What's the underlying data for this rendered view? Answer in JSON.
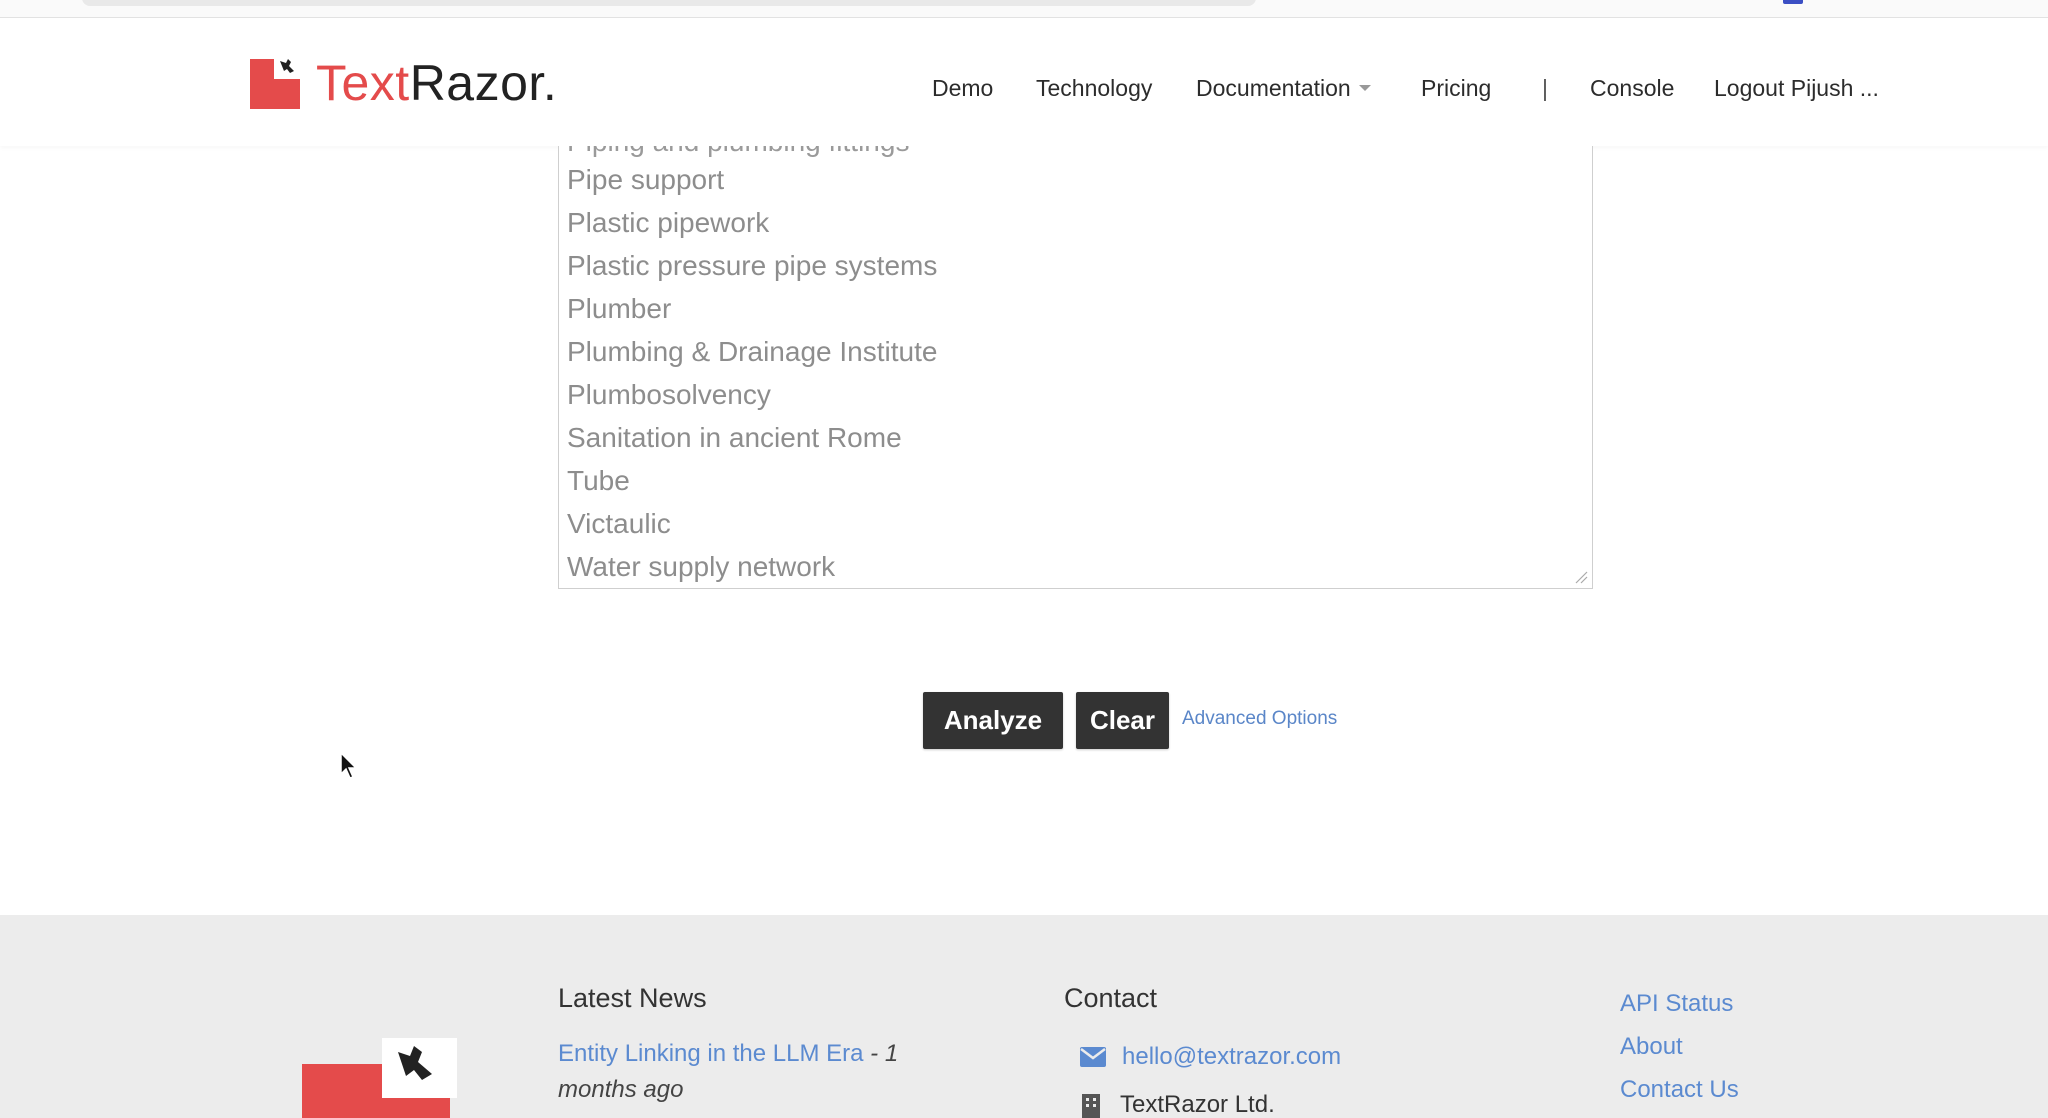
{
  "brand": {
    "name_part1": "Text",
    "name_part2": "Razor",
    "name_suffix": ".",
    "accent_color": "#e44b4b"
  },
  "nav": {
    "demo": "Demo",
    "technology": "Technology",
    "documentation": "Documentation",
    "pricing": "Pricing",
    "separator": "|",
    "console": "Console",
    "logout": "Logout Pijush ..."
  },
  "entities": {
    "partial_top": "Piping and plumbing fittings",
    "items": [
      "Pipe support",
      "Plastic pipework",
      "Plastic pressure pipe systems",
      "Plumber",
      "Plumbing & Drainage Institute",
      "Plumbosolvency",
      "Sanitation in ancient Rome",
      "Tube",
      "Victaulic",
      "Water supply network"
    ]
  },
  "actions": {
    "analyze": "Analyze",
    "clear": "Clear",
    "advanced": "Advanced Options"
  },
  "footer": {
    "news_heading": "Latest News",
    "news_link": "Entity Linking in the LLM Era",
    "news_dash": " - ",
    "news_age_1": "1",
    "news_age_2": "months ago",
    "contact_heading": "Contact",
    "email": "hello@textrazor.com",
    "company": "TextRazor Ltd.",
    "links": [
      "API Status",
      "About",
      "Contact Us"
    ]
  },
  "icons": {
    "logo": "textrazor-logo-icon",
    "mail": "mail-icon",
    "building": "building-icon",
    "cursor": "mouse-cursor-icon",
    "caret": "caret-down-icon"
  }
}
